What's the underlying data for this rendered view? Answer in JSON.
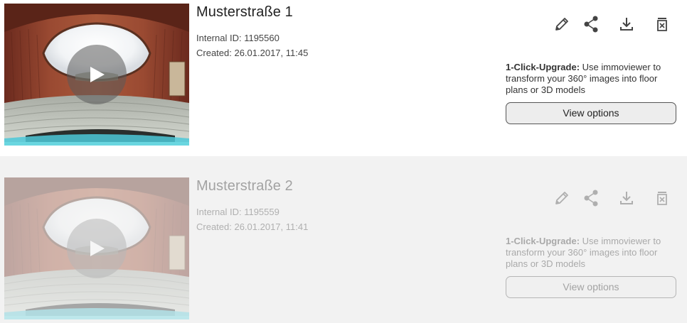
{
  "listings": [
    {
      "title": "Musterstraße 1",
      "internal_id": "Internal ID: 1195560",
      "created": "Created: 26.01.2017, 11:45",
      "upgrade_bold": "1-Click-Upgrade:",
      "upgrade_text": " Use immoviewer to transform your 360° images into floor plans or 3D models",
      "view_options_label": "View options",
      "state": "active"
    },
    {
      "title": "Musterstraße 2",
      "internal_id": "Internal ID: 1195559",
      "created": "Created: 26.01.2017, 11:41",
      "upgrade_bold": "1-Click-Upgrade:",
      "upgrade_text": " Use immoviewer to transform your 360° images into floor plans or 3D models",
      "view_options_label": "View options",
      "state": "disabled"
    }
  ],
  "icons": {
    "play": "play-icon",
    "edit": "pencil-icon",
    "share": "share-icon",
    "download": "download-icon",
    "delete": "trash-icon"
  },
  "colors": {
    "icon": "#444444",
    "button_border": "#555555",
    "button_bg": "#ededed",
    "card_bg": "#ffffff",
    "page_bg": "#f0f0f0"
  }
}
